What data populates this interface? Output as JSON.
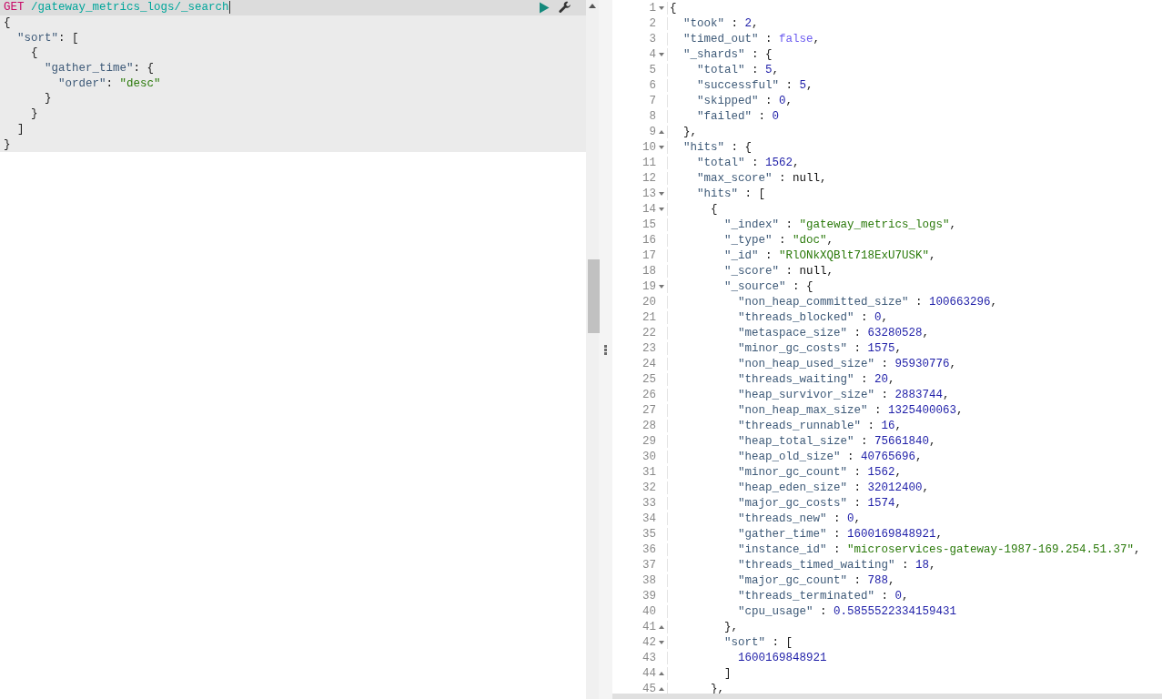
{
  "request": {
    "lines": [
      {
        "cursor": true,
        "tokens": [
          {
            "kind": "method",
            "text": "GET"
          },
          {
            "kind": "url",
            "text": "/gateway_metrics_logs/_search"
          }
        ]
      },
      {
        "tokens": [
          {
            "kind": "punct",
            "text": "{"
          }
        ]
      },
      {
        "tokens": [
          {
            "kind": "key",
            "text": "  \"sort\""
          },
          {
            "kind": "punct",
            "text": ": ["
          }
        ]
      },
      {
        "tokens": [
          {
            "kind": "punct",
            "text": "    {"
          }
        ]
      },
      {
        "tokens": [
          {
            "kind": "key",
            "text": "      \"gather_time\""
          },
          {
            "kind": "punct",
            "text": ": {"
          }
        ]
      },
      {
        "tokens": [
          {
            "kind": "key",
            "text": "        \"order\""
          },
          {
            "kind": "punct",
            "text": ": "
          },
          {
            "kind": "string",
            "text": "\"desc\""
          }
        ]
      },
      {
        "tokens": [
          {
            "kind": "punct",
            "text": "      }"
          }
        ]
      },
      {
        "tokens": [
          {
            "kind": "punct",
            "text": "    }"
          }
        ]
      },
      {
        "tokens": [
          {
            "kind": "punct",
            "text": "  ]"
          }
        ]
      },
      {
        "tokens": [
          {
            "kind": "punct",
            "text": "}"
          }
        ]
      }
    ]
  },
  "response": {
    "lines": [
      {
        "n": "1",
        "block_start": true,
        "tokens": [
          {
            "kind": "punct",
            "text": "{"
          }
        ]
      },
      {
        "n": "2",
        "tokens": [
          {
            "kind": "key",
            "text": "  \"took\""
          },
          {
            "kind": "punct",
            "text": " : "
          },
          {
            "kind": "number",
            "text": "2"
          },
          {
            "kind": "punct",
            "text": ","
          }
        ]
      },
      {
        "n": "3",
        "tokens": [
          {
            "kind": "key",
            "text": "  \"timed_out\""
          },
          {
            "kind": "punct",
            "text": " : "
          },
          {
            "kind": "boolean",
            "text": "false"
          },
          {
            "kind": "punct",
            "text": ","
          }
        ]
      },
      {
        "n": "4",
        "block_start": true,
        "tokens": [
          {
            "kind": "key",
            "text": "  \"_shards\""
          },
          {
            "kind": "punct",
            "text": " : {"
          }
        ]
      },
      {
        "n": "5",
        "tokens": [
          {
            "kind": "key",
            "text": "    \"total\""
          },
          {
            "kind": "punct",
            "text": " : "
          },
          {
            "kind": "number",
            "text": "5"
          },
          {
            "kind": "punct",
            "text": ","
          }
        ]
      },
      {
        "n": "6",
        "tokens": [
          {
            "kind": "key",
            "text": "    \"successful\""
          },
          {
            "kind": "punct",
            "text": " : "
          },
          {
            "kind": "number",
            "text": "5"
          },
          {
            "kind": "punct",
            "text": ","
          }
        ]
      },
      {
        "n": "7",
        "tokens": [
          {
            "kind": "key",
            "text": "    \"skipped\""
          },
          {
            "kind": "punct",
            "text": " : "
          },
          {
            "kind": "number",
            "text": "0"
          },
          {
            "kind": "punct",
            "text": ","
          }
        ]
      },
      {
        "n": "8",
        "tokens": [
          {
            "kind": "key",
            "text": "    \"failed\""
          },
          {
            "kind": "punct",
            "text": " : "
          },
          {
            "kind": "number",
            "text": "0"
          }
        ]
      },
      {
        "n": "9",
        "block_start": false,
        "tokens": [
          {
            "kind": "punct",
            "text": "  },"
          }
        ]
      },
      {
        "n": "10",
        "block_start": true,
        "tokens": [
          {
            "kind": "key",
            "text": "  \"hits\""
          },
          {
            "kind": "punct",
            "text": " : {"
          }
        ]
      },
      {
        "n": "11",
        "tokens": [
          {
            "kind": "key",
            "text": "    \"total\""
          },
          {
            "kind": "punct",
            "text": " : "
          },
          {
            "kind": "number",
            "text": "1562"
          },
          {
            "kind": "punct",
            "text": ","
          }
        ]
      },
      {
        "n": "12",
        "tokens": [
          {
            "kind": "key",
            "text": "    \"max_score\""
          },
          {
            "kind": "punct",
            "text": " : "
          },
          {
            "kind": "null",
            "text": "null"
          },
          {
            "kind": "punct",
            "text": ","
          }
        ]
      },
      {
        "n": "13",
        "block_start": true,
        "tokens": [
          {
            "kind": "key",
            "text": "    \"hits\""
          },
          {
            "kind": "punct",
            "text": " : ["
          }
        ]
      },
      {
        "n": "14",
        "block_start": true,
        "tokens": [
          {
            "kind": "punct",
            "text": "      {"
          }
        ]
      },
      {
        "n": "15",
        "tokens": [
          {
            "kind": "key",
            "text": "        \"_index\""
          },
          {
            "kind": "punct",
            "text": " : "
          },
          {
            "kind": "string",
            "text": "\"gateway_metrics_logs\""
          },
          {
            "kind": "punct",
            "text": ","
          }
        ]
      },
      {
        "n": "16",
        "tokens": [
          {
            "kind": "key",
            "text": "        \"_type\""
          },
          {
            "kind": "punct",
            "text": " : "
          },
          {
            "kind": "string",
            "text": "\"doc\""
          },
          {
            "kind": "punct",
            "text": ","
          }
        ]
      },
      {
        "n": "17",
        "tokens": [
          {
            "kind": "key",
            "text": "        \"_id\""
          },
          {
            "kind": "punct",
            "text": " : "
          },
          {
            "kind": "string",
            "text": "\"RlONkXQBlt718ExU7USK\""
          },
          {
            "kind": "punct",
            "text": ","
          }
        ]
      },
      {
        "n": "18",
        "tokens": [
          {
            "kind": "key",
            "text": "        \"_score\""
          },
          {
            "kind": "punct",
            "text": " : "
          },
          {
            "kind": "null",
            "text": "null"
          },
          {
            "kind": "punct",
            "text": ","
          }
        ]
      },
      {
        "n": "19",
        "block_start": true,
        "tokens": [
          {
            "kind": "key",
            "text": "        \"_source\""
          },
          {
            "kind": "punct",
            "text": " : {"
          }
        ]
      },
      {
        "n": "20",
        "tokens": [
          {
            "kind": "key",
            "text": "          \"non_heap_committed_size\""
          },
          {
            "kind": "punct",
            "text": " : "
          },
          {
            "kind": "number",
            "text": "100663296"
          },
          {
            "kind": "punct",
            "text": ","
          }
        ]
      },
      {
        "n": "21",
        "tokens": [
          {
            "kind": "key",
            "text": "          \"threads_blocked\""
          },
          {
            "kind": "punct",
            "text": " : "
          },
          {
            "kind": "number",
            "text": "0"
          },
          {
            "kind": "punct",
            "text": ","
          }
        ]
      },
      {
        "n": "22",
        "tokens": [
          {
            "kind": "key",
            "text": "          \"metaspace_size\""
          },
          {
            "kind": "punct",
            "text": " : "
          },
          {
            "kind": "number",
            "text": "63280528"
          },
          {
            "kind": "punct",
            "text": ","
          }
        ]
      },
      {
        "n": "23",
        "tokens": [
          {
            "kind": "key",
            "text": "          \"minor_gc_costs\""
          },
          {
            "kind": "punct",
            "text": " : "
          },
          {
            "kind": "number",
            "text": "1575"
          },
          {
            "kind": "punct",
            "text": ","
          }
        ]
      },
      {
        "n": "24",
        "tokens": [
          {
            "kind": "key",
            "text": "          \"non_heap_used_size\""
          },
          {
            "kind": "punct",
            "text": " : "
          },
          {
            "kind": "number",
            "text": "95930776"
          },
          {
            "kind": "punct",
            "text": ","
          }
        ]
      },
      {
        "n": "25",
        "tokens": [
          {
            "kind": "key",
            "text": "          \"threads_waiting\""
          },
          {
            "kind": "punct",
            "text": " : "
          },
          {
            "kind": "number",
            "text": "20"
          },
          {
            "kind": "punct",
            "text": ","
          }
        ]
      },
      {
        "n": "26",
        "tokens": [
          {
            "kind": "key",
            "text": "          \"heap_survivor_size\""
          },
          {
            "kind": "punct",
            "text": " : "
          },
          {
            "kind": "number",
            "text": "2883744"
          },
          {
            "kind": "punct",
            "text": ","
          }
        ]
      },
      {
        "n": "27",
        "tokens": [
          {
            "kind": "key",
            "text": "          \"non_heap_max_size\""
          },
          {
            "kind": "punct",
            "text": " : "
          },
          {
            "kind": "number",
            "text": "1325400063"
          },
          {
            "kind": "punct",
            "text": ","
          }
        ]
      },
      {
        "n": "28",
        "tokens": [
          {
            "kind": "key",
            "text": "          \"threads_runnable\""
          },
          {
            "kind": "punct",
            "text": " : "
          },
          {
            "kind": "number",
            "text": "16"
          },
          {
            "kind": "punct",
            "text": ","
          }
        ]
      },
      {
        "n": "29",
        "tokens": [
          {
            "kind": "key",
            "text": "          \"heap_total_size\""
          },
          {
            "kind": "punct",
            "text": " : "
          },
          {
            "kind": "number",
            "text": "75661840"
          },
          {
            "kind": "punct",
            "text": ","
          }
        ]
      },
      {
        "n": "30",
        "tokens": [
          {
            "kind": "key",
            "text": "          \"heap_old_size\""
          },
          {
            "kind": "punct",
            "text": " : "
          },
          {
            "kind": "number",
            "text": "40765696"
          },
          {
            "kind": "punct",
            "text": ","
          }
        ]
      },
      {
        "n": "31",
        "tokens": [
          {
            "kind": "key",
            "text": "          \"minor_gc_count\""
          },
          {
            "kind": "punct",
            "text": " : "
          },
          {
            "kind": "number",
            "text": "1562"
          },
          {
            "kind": "punct",
            "text": ","
          }
        ]
      },
      {
        "n": "32",
        "tokens": [
          {
            "kind": "key",
            "text": "          \"heap_eden_size\""
          },
          {
            "kind": "punct",
            "text": " : "
          },
          {
            "kind": "number",
            "text": "32012400"
          },
          {
            "kind": "punct",
            "text": ","
          }
        ]
      },
      {
        "n": "33",
        "tokens": [
          {
            "kind": "key",
            "text": "          \"major_gc_costs\""
          },
          {
            "kind": "punct",
            "text": " : "
          },
          {
            "kind": "number",
            "text": "1574"
          },
          {
            "kind": "punct",
            "text": ","
          }
        ]
      },
      {
        "n": "34",
        "tokens": [
          {
            "kind": "key",
            "text": "          \"threads_new\""
          },
          {
            "kind": "punct",
            "text": " : "
          },
          {
            "kind": "number",
            "text": "0"
          },
          {
            "kind": "punct",
            "text": ","
          }
        ]
      },
      {
        "n": "35",
        "tokens": [
          {
            "kind": "key",
            "text": "          \"gather_time\""
          },
          {
            "kind": "punct",
            "text": " : "
          },
          {
            "kind": "number",
            "text": "1600169848921"
          },
          {
            "kind": "punct",
            "text": ","
          }
        ]
      },
      {
        "n": "36",
        "tokens": [
          {
            "kind": "key",
            "text": "          \"instance_id\""
          },
          {
            "kind": "punct",
            "text": " : "
          },
          {
            "kind": "string",
            "text": "\"microservices-gateway-1987-169.254.51.37\""
          },
          {
            "kind": "punct",
            "text": ","
          }
        ]
      },
      {
        "n": "37",
        "tokens": [
          {
            "kind": "key",
            "text": "          \"threads_timed_waiting\""
          },
          {
            "kind": "punct",
            "text": " : "
          },
          {
            "kind": "number",
            "text": "18"
          },
          {
            "kind": "punct",
            "text": ","
          }
        ]
      },
      {
        "n": "38",
        "tokens": [
          {
            "kind": "key",
            "text": "          \"major_gc_count\""
          },
          {
            "kind": "punct",
            "text": " : "
          },
          {
            "kind": "number",
            "text": "788"
          },
          {
            "kind": "punct",
            "text": ","
          }
        ]
      },
      {
        "n": "39",
        "tokens": [
          {
            "kind": "key",
            "text": "          \"threads_terminated\""
          },
          {
            "kind": "punct",
            "text": " : "
          },
          {
            "kind": "number",
            "text": "0"
          },
          {
            "kind": "punct",
            "text": ","
          }
        ]
      },
      {
        "n": "40",
        "tokens": [
          {
            "kind": "key",
            "text": "          \"cpu_usage\""
          },
          {
            "kind": "punct",
            "text": " : "
          },
          {
            "kind": "number",
            "text": "0.5855522334159431"
          }
        ]
      },
      {
        "n": "41",
        "block_start": false,
        "tokens": [
          {
            "kind": "punct",
            "text": "        },"
          }
        ]
      },
      {
        "n": "42",
        "block_start": true,
        "tokens": [
          {
            "kind": "key",
            "text": "        \"sort\""
          },
          {
            "kind": "punct",
            "text": " : ["
          }
        ]
      },
      {
        "n": "43",
        "tokens": [
          {
            "kind": "number",
            "text": "          1600169848921"
          }
        ]
      },
      {
        "n": "44",
        "block_start": false,
        "tokens": [
          {
            "kind": "punct",
            "text": "        ]"
          }
        ]
      },
      {
        "n": "45",
        "block_start": false,
        "tokens": [
          {
            "kind": "punct",
            "text": "      },"
          }
        ]
      }
    ]
  }
}
